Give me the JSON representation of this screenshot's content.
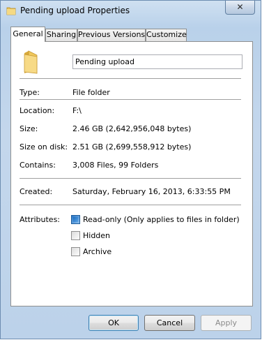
{
  "window": {
    "title": "Pending upload Properties",
    "close_symbol": "✕"
  },
  "tabs": [
    {
      "label": "General",
      "active": true
    },
    {
      "label": "Sharing",
      "active": false
    },
    {
      "label": "Previous Versions",
      "active": false
    },
    {
      "label": "Customize",
      "active": false
    }
  ],
  "general": {
    "name_value": "Pending upload",
    "type_label": "Type:",
    "type_value": "File folder",
    "location_label": "Location:",
    "location_value": "F:\\",
    "size_label": "Size:",
    "size_value": "2.46 GB (2,642,956,048 bytes)",
    "size_on_disk_label": "Size on disk:",
    "size_on_disk_value": "2.51 GB (2,699,558,912 bytes)",
    "contains_label": "Contains:",
    "contains_value": "3,008 Files, 99 Folders",
    "created_label": "Created:",
    "created_value": "Saturday, February 16, 2013, 6:33:55 PM",
    "attributes_label": "Attributes:",
    "attributes": [
      {
        "label": "Read-only (Only applies to files in folder)",
        "state": "indeterminate"
      },
      {
        "label": "Hidden",
        "state": "unchecked"
      },
      {
        "label": "Archive",
        "state": "unchecked"
      }
    ]
  },
  "buttons": {
    "ok": "OK",
    "cancel": "Cancel",
    "apply": "Apply",
    "apply_enabled": false
  },
  "colors": {
    "frame": "#bcd2ea",
    "checkbox_accent": "#2a76c6"
  }
}
